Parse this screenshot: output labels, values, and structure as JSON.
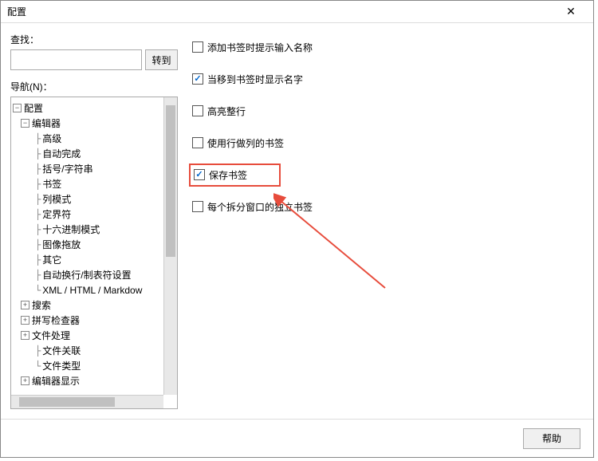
{
  "dialog": {
    "title": "配置"
  },
  "search": {
    "label": "查找：",
    "goto": "转到",
    "value": ""
  },
  "nav": {
    "label": "导航(N)："
  },
  "tree": {
    "root": "配置",
    "editor": "编辑器",
    "advanced": "高级",
    "autocomplete": "自动完成",
    "brackets": "括号/字符串",
    "bookmark": "书签",
    "column_mode": "列模式",
    "delimiter": "定界符",
    "hex_mode": "十六进制模式",
    "image_drag": "图像拖放",
    "misc": "其它",
    "wrap_tab": "自动换行/制表符设置",
    "xml_html": "XML / HTML / Markdow",
    "search": "搜索",
    "spell": "拼写检查器",
    "file_handling": "文件处理",
    "file_assoc": "文件关联",
    "file_type": "文件类型",
    "editor_display": "编辑器显示"
  },
  "options": {
    "add_bookmark_prompt": "添加书签时提示输入名称",
    "show_name_on_hover": "当移到书签时显示名字",
    "highlight_line": "高亮整行",
    "use_column_bookmark": "使用行做列的书签",
    "save_bookmark": "保存书签",
    "split_window_bookmark": "每个拆分窗口的独立书签"
  },
  "footer": {
    "help": "帮助"
  }
}
